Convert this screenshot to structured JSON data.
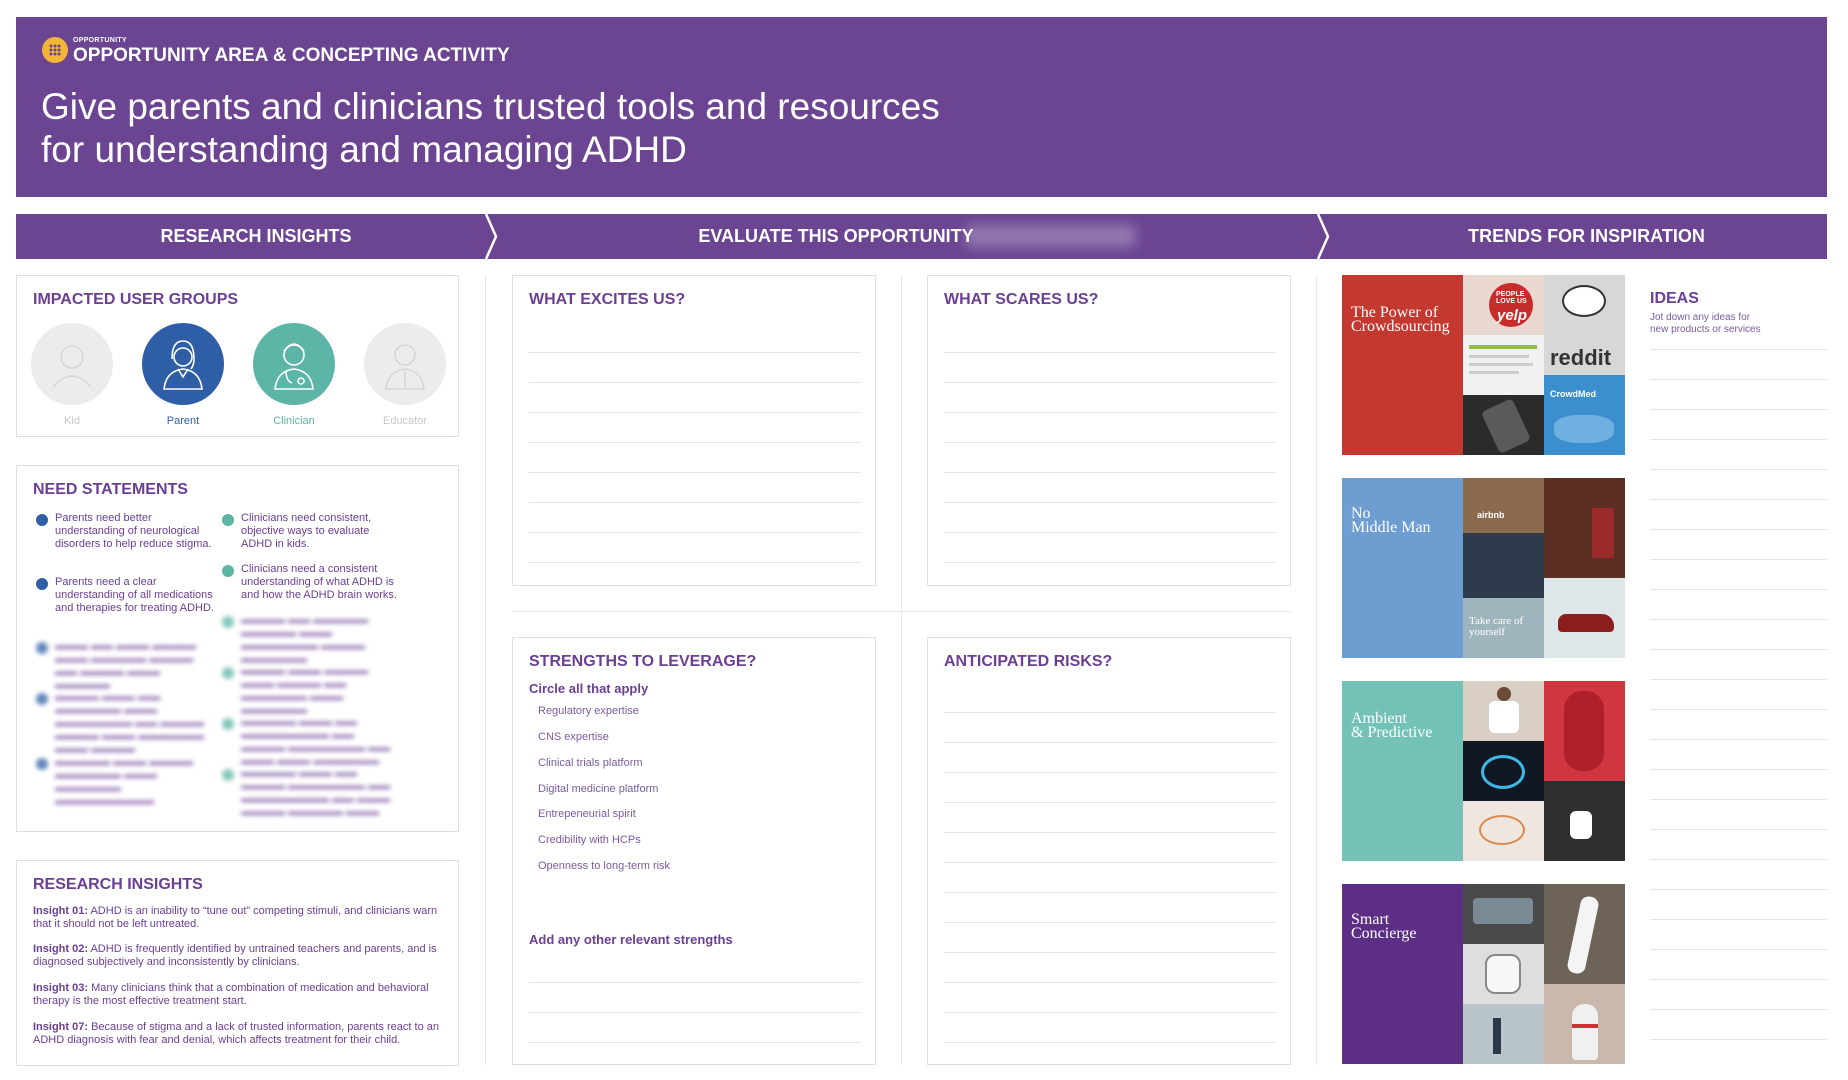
{
  "header": {
    "kicker": "OPPORTUNITY",
    "activity_title": "OPPORTUNITY AREA & CONCEPTING ACTIVITY",
    "headline_line1": "Give parents and clinicians trusted tools and resources",
    "headline_line2": "for understanding and managing ADHD",
    "brand_color": "#6b4492",
    "badge_color": "#f2b636"
  },
  "sections": {
    "research": "RESEARCH INSIGHTS",
    "evaluate": "EVALUATE THIS OPPORTUNITY",
    "trends": "TRENDS FOR INSPIRATION"
  },
  "user_groups": {
    "title": "IMPACTED USER GROUPS",
    "groups": [
      {
        "label": "Kid",
        "active": false,
        "color": "#e4e4e4",
        "icon": "kid-icon"
      },
      {
        "label": "Parent",
        "active": true,
        "color": "#2e5fa6",
        "icon": "parent-icon"
      },
      {
        "label": "Clinician",
        "active": true,
        "color": "#5db5a7",
        "icon": "clinician-icon"
      },
      {
        "label": "Educator",
        "active": false,
        "color": "#e4e4e4",
        "icon": "educator-icon"
      }
    ]
  },
  "needs": {
    "title": "NEED STATEMENTS",
    "parent": [
      "Parents need better understanding of neurological disorders to help reduce stigma.",
      "Parents need a clear understanding of all medications and therapies for treating ADHD."
    ],
    "clinician": [
      "Clinicians need consistent, objective ways to evaluate ADHD in kids.",
      "Clinicians need a consistent understanding of what ADHD is and how the ADHD brain works."
    ]
  },
  "insights": {
    "title": "RESEARCH INSIGHTS",
    "items": [
      {
        "id": "Insight 01:",
        "text": "ADHD is an inability to “tune out” competing stimuli, and clinicians warn that it should not be left untreated."
      },
      {
        "id": "Insight 02:",
        "text": "ADHD is frequently identified by untrained teachers and parents, and is diagnosed subjectively and inconsistently by clinicians."
      },
      {
        "id": "Insight 03:",
        "text": "Many clinicians think that a combination of medication and behavioral therapy is the most effective treatment start."
      },
      {
        "id": "Insight 07:",
        "text": "Because of stigma and a lack of trusted information, parents react to an ADHD diagnosis with fear and denial, which affects treatment for their child."
      }
    ]
  },
  "evaluate": {
    "excites": "WHAT EXCITES US?",
    "scares": "WHAT SCARES US?",
    "strengths": "STRENGTHS TO LEVERAGE?",
    "circle": "Circle all that apply",
    "strength_items": [
      "Regulatory expertise",
      "CNS expertise",
      "Clinical trials platform",
      "Digital medicine platform",
      "Entrepeneurial spirit",
      "Credibility with HCPs",
      "Openness to long-term risk"
    ],
    "add_other": "Add any other relevant strengths",
    "risks": "ANTICIPATED RISKS?"
  },
  "trends": [
    {
      "label_line1": "The Power of",
      "label_line2": "Crowdsourcing",
      "color": "#c4392f",
      "tile_texts": [
        "PEOPLE LOVE US",
        "yelp",
        "reddit",
        "CrowdMed"
      ]
    },
    {
      "label_line1": "No",
      "label_line2": "Middle Man",
      "color": "#6d9dd1",
      "tile_texts": [
        "airbnb",
        "Take care of yourself"
      ]
    },
    {
      "label_line1": "Ambient",
      "label_line2": "& Predictive",
      "color": "#74c2b7",
      "tile_texts": []
    },
    {
      "label_line1": "Smart",
      "label_line2": "Concierge",
      "color": "#5c2e86",
      "tile_texts": []
    }
  ],
  "ideas": {
    "title": "IDEAS",
    "subtitle_line1": "Jot down any ideas for",
    "subtitle_line2": "new products or services"
  }
}
